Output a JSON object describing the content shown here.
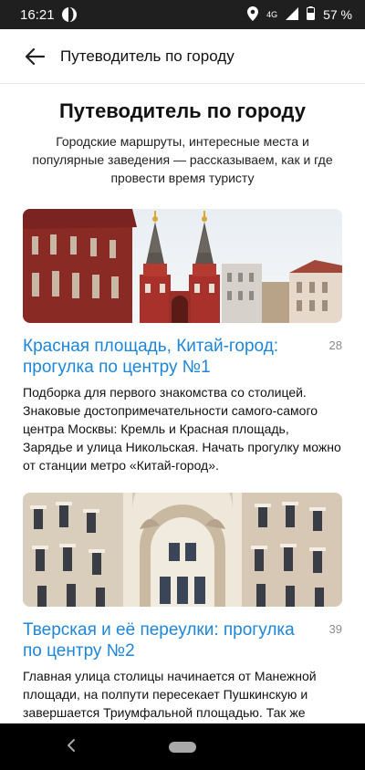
{
  "status_bar": {
    "time": "16:21",
    "network": "4G",
    "battery": "57 %"
  },
  "app_bar": {
    "title": "Путеводитель по городу",
    "back_icon": "arrow-back-icon"
  },
  "header": {
    "title": "Путеводитель по городу",
    "subtitle": "Городские маршруты, интересные места и популярные заведения — рассказываем, как и где провести время туристу"
  },
  "articles": [
    {
      "title": "Красная площадь, Китай-город: прогулка по центру №1",
      "count": "28",
      "description": "Подборка для первого знакомства со столицей. Знаковые достопримечательности самого-самого центра Москвы: Кремль и Красная площадь, Зарядье и улица Никольская. Начать прогулку можно от станции метро «Китай-город»."
    },
    {
      "title": "Тверская и её переулки: прогулка по центру №2",
      "count": "39",
      "description": "Главная улица столицы начинается от Манежной площади, на полпути пересекает Пушкинскую и завершается Триумфальной площадью. Так же прогуляемся и мы — от метро «Охотный ряд» до метро «Маяковская», сворачивая в переулки и на"
    }
  ]
}
